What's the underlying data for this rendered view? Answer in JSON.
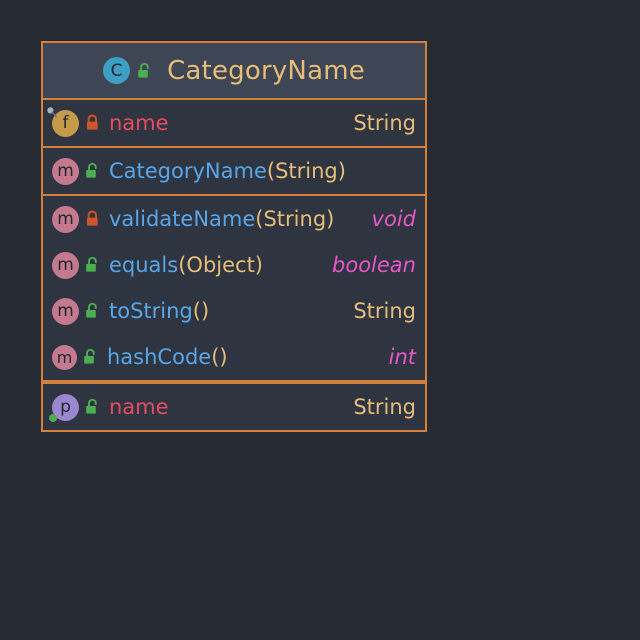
{
  "diagram": {
    "kind": "uml-class-diagram",
    "colors": {
      "page_background": "#262b33",
      "class_background": "#2e3440",
      "header_background": "#3e4554",
      "border": "#d2803a",
      "class_name": "#e5bd79",
      "field_name": "#e64c60",
      "method_name": "#58a6e8",
      "class_type": "#e5bd79",
      "primitive_type": "#e857c8",
      "lock_public": "#4caf50",
      "lock_private": "#d2542a",
      "icon_class": "#3d9fc4",
      "icon_field": "#c59a4a",
      "icon_method": "#c4798f",
      "icon_property": "#9b87cf"
    }
  },
  "uml_class": {
    "header": {
      "name": "CategoryName",
      "icon": "class-icon",
      "icon_letter": "C",
      "visibility": "public",
      "visibility_icon": "unlocked-padlock-icon"
    },
    "groups": [
      {
        "group": "fields",
        "members": [
          {
            "icon": "field-icon",
            "icon_letter": "f",
            "visibility": "private",
            "visibility_icon": "locked-padlock-icon",
            "name": "name",
            "name_kind": "field",
            "params": "",
            "type": "String",
            "type_kind": "class"
          }
        ]
      },
      {
        "group": "constructors",
        "members": [
          {
            "icon": "method-icon",
            "icon_letter": "m",
            "visibility": "public",
            "visibility_icon": "unlocked-padlock-icon",
            "name": "CategoryName",
            "name_kind": "method",
            "params": "(String)",
            "type": "",
            "type_kind": "none"
          }
        ]
      },
      {
        "group": "methods",
        "members": [
          {
            "icon": "method-icon",
            "icon_letter": "m",
            "visibility": "private",
            "visibility_icon": "locked-padlock-icon",
            "name": "validateName",
            "name_kind": "method",
            "params": "(String)",
            "type": "void",
            "type_kind": "primitive"
          },
          {
            "icon": "method-icon",
            "icon_letter": "m",
            "visibility": "public",
            "visibility_icon": "unlocked-padlock-icon",
            "name": "equals",
            "name_kind": "method",
            "params": "(Object)",
            "type": "boolean",
            "type_kind": "primitive"
          },
          {
            "icon": "method-icon",
            "icon_letter": "m",
            "visibility": "public",
            "visibility_icon": "unlocked-padlock-icon",
            "name": "toString",
            "name_kind": "method",
            "params": "()",
            "type": "String",
            "type_kind": "class"
          },
          {
            "icon": "method-icon",
            "icon_letter": "m",
            "visibility": "public",
            "visibility_icon": "unlocked-padlock-icon",
            "name": "hashCode",
            "name_kind": "method",
            "params": "()",
            "type": "int",
            "type_kind": "primitive"
          }
        ]
      },
      {
        "group": "properties",
        "members": [
          {
            "icon": "property-icon",
            "icon_letter": "p",
            "visibility": "public",
            "visibility_icon": "unlocked-padlock-icon",
            "name": "name",
            "name_kind": "field",
            "params": "",
            "type": "String",
            "type_kind": "class"
          }
        ]
      }
    ]
  }
}
